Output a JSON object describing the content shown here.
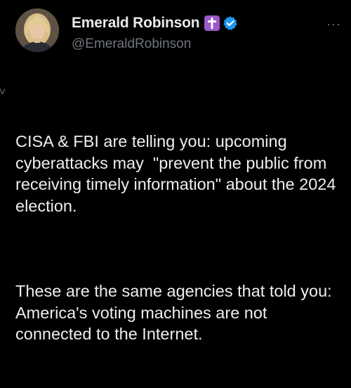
{
  "post": {
    "author": {
      "display_name": "Emerald Robinson",
      "handle": "@EmeraldRobinson",
      "badge_icon": "cross-icon",
      "verified_icon": "verified-badge-icon"
    },
    "more_label": "···",
    "paragraphs": [
      "CISA & FBI are telling you: upcoming cyberattacks may  \"prevent the public from receiving timely information\" about the 2024 election.",
      "These are the same agencies that told you: America's voting machines are not connected to the Internet."
    ]
  },
  "colors": {
    "background": "#000000",
    "text": "#e7e9ea",
    "secondary_text": "#71767b",
    "badge_purple": "#9b59c9",
    "verified_blue": "#1d9bf0"
  }
}
